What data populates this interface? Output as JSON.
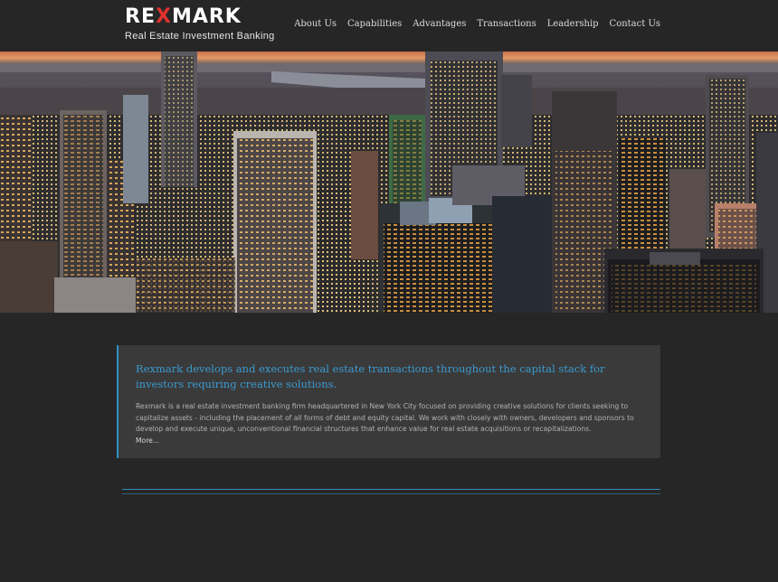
{
  "brand": {
    "name_part1": "RE",
    "name_x": "X",
    "name_part2": "MARK",
    "tagline": "Real Estate Investment Banking"
  },
  "nav": {
    "items": [
      {
        "label": "About Us"
      },
      {
        "label": "Capabilities"
      },
      {
        "label": "Advantages"
      },
      {
        "label": "Transactions"
      },
      {
        "label": "Leadership"
      },
      {
        "label": "Contact Us"
      }
    ]
  },
  "hero": {
    "image": "city-skyline-at-dusk"
  },
  "intro": {
    "headline": "Rexmark develops and executes real estate transactions throughout the capital stack for investors requiring creative solutions.",
    "body": "Rexmark is a real estate investment banking firm headquartered in New York City focused on providing creative solutions for clients seeking to capitalize assets - including the placement of all forms of debt and equity capital. We work with closely with owners, developers and sponsors to develop and execute unique, unconventional financial structures that enhance value for real estate acquisitions or recapitalizations.",
    "more_label": "More..."
  },
  "colors": {
    "background": "#262626",
    "panel": "#3a3a3a",
    "accent": "#2f8fbf",
    "brand_red": "#e0322f"
  }
}
